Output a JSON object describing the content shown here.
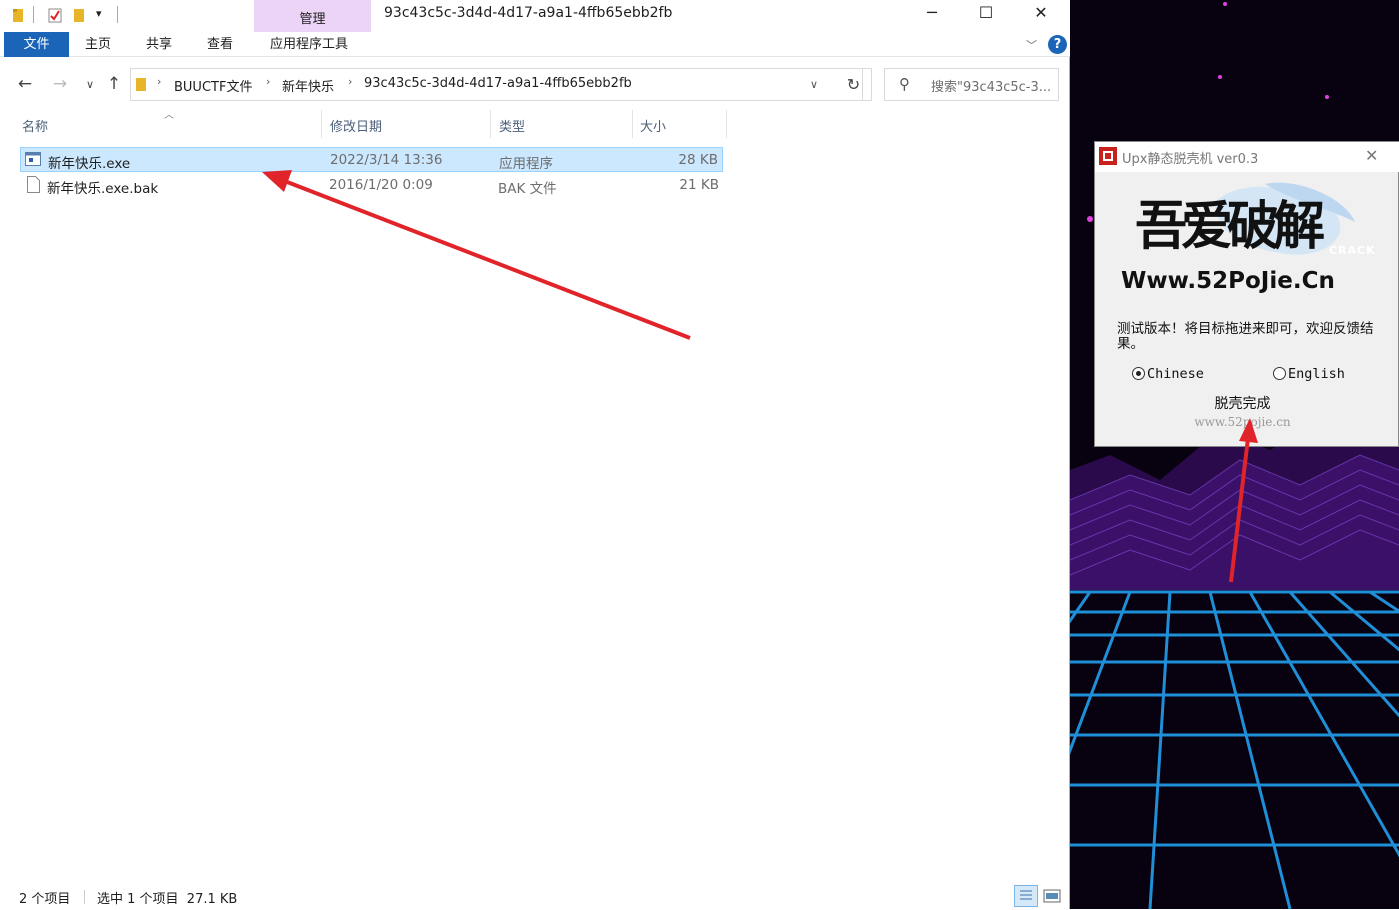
{
  "window": {
    "title": "93c43c5c-3d4d-4d17-a9a1-4ffb65ebb2fb",
    "context_tab_group": "管理",
    "controls": {
      "minimize": "─",
      "maximize": "☐",
      "close": "✕"
    }
  },
  "ribbon": {
    "tabs": [
      {
        "label": "文件",
        "active": true
      },
      {
        "label": "主页"
      },
      {
        "label": "共享"
      },
      {
        "label": "查看"
      },
      {
        "label": "应用程序工具"
      }
    ],
    "help": "?"
  },
  "address": {
    "crumbs": [
      "BUUCTF文件",
      "新年快乐",
      "93c43c5c-3d4d-4d17-a9a1-4ffb65ebb2fb"
    ],
    "search_placeholder": "搜索\"93c43c5c-3..."
  },
  "columns": [
    "名称",
    "修改日期",
    "类型",
    "大小"
  ],
  "files": [
    {
      "name": "新年快乐.exe",
      "date": "2022/3/14 13:36",
      "type": "应用程序",
      "size": "28 KB",
      "selected": true,
      "icon": "exe-icon"
    },
    {
      "name": "新年快乐.exe.bak",
      "date": "2016/1/20 0:09",
      "type": "BAK 文件",
      "size": "21 KB",
      "selected": false,
      "icon": "file-icon"
    }
  ],
  "status": {
    "count": "2 个项目",
    "selection": "选中 1 个项目  27.1 KB"
  },
  "upx_dialog": {
    "title": "Upx静态脱壳机 ver0.3",
    "logo_text": "吾爱破解",
    "logo_crack": "CRACK",
    "logo_url": "Www.52PoJie.Cn",
    "description": "测试版本！将目标拖进来即可，欢迎反馈结果。",
    "radio_chinese": "Chinese",
    "radio_english": "English",
    "selected_language": "Chinese",
    "status": "脱壳完成",
    "site": "www.52pojie.cn"
  },
  "colors": {
    "accent": "#1a65b8",
    "selection": "#cce8ff",
    "context_tab": "#ecd4f6",
    "annotation_arrow": "#e0242a"
  }
}
